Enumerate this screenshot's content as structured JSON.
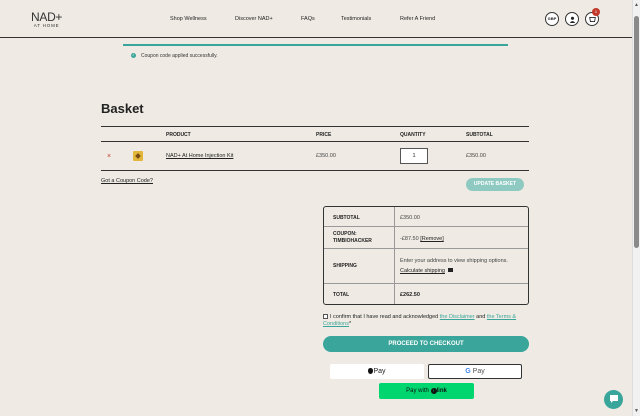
{
  "header": {
    "logo_main": "NAD+",
    "logo_sub": "AT HOME",
    "nav": [
      "Shop Wellness",
      "Discover NAD+",
      "FAQs",
      "Testimonials",
      "Refer A Friend"
    ],
    "currency": "GBP",
    "cart_count": "1"
  },
  "notice": {
    "text": "Coupon code applied successfully."
  },
  "page_title": "Basket",
  "table": {
    "headers": {
      "product": "PRODUCT",
      "price": "PRICE",
      "quantity": "QUANTITY",
      "subtotal": "SUBTOTAL"
    },
    "rows": [
      {
        "remove": "×",
        "name": "NAD+ At Home Injection Kit",
        "price": "£350.00",
        "quantity": "1",
        "subtotal": "£350.00"
      }
    ]
  },
  "coupon_link": "Got a Coupon Code?",
  "update_basket": "UPDATE BASKET",
  "totals": {
    "subtotal_label": "SUBTOTAL",
    "subtotal_value": "£350.00",
    "coupon_label": "COUPON: TIMBIOHACKER",
    "coupon_value": "-£87.50",
    "coupon_remove": "[Remove]",
    "shipping_label": "SHIPPING",
    "shipping_text": "Enter your address to view shipping options.",
    "shipping_calc": "Calculate shipping",
    "total_label": "TOTAL",
    "total_value": "£262.50"
  },
  "confirm": {
    "prefix": "I confirm that I have read and acknowledged",
    "disclaimer": "the Disclaimer",
    "and": "and",
    "terms": "the Terms & Conditions",
    "required": "*"
  },
  "checkout_button": "PROCEED TO CHECKOUT",
  "apple_pay": "Pay",
  "google_pay": "Pay",
  "link_pay": {
    "prefix": "Pay with",
    "brand": "link"
  },
  "colors": {
    "accent": "#3aa59a",
    "background": "#efebe4",
    "link_green": "#00d66f",
    "remove_red": "#c0392b"
  }
}
